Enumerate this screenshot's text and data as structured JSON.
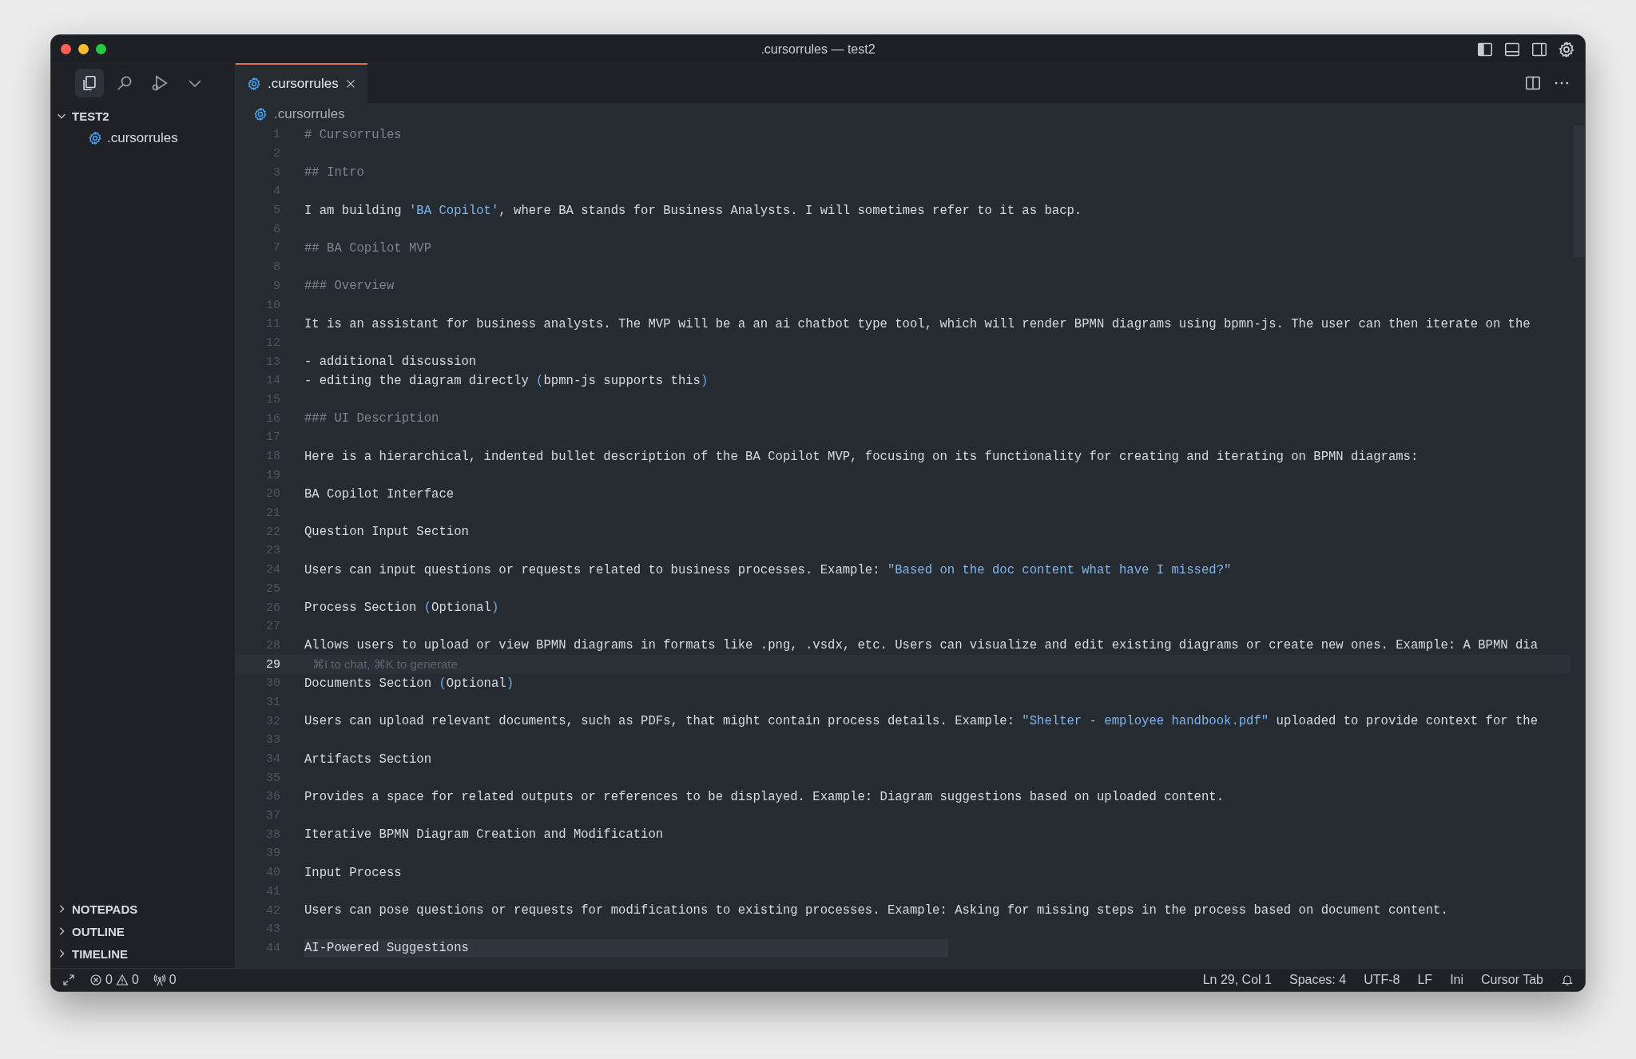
{
  "window": {
    "title": ".cursorrules — test2"
  },
  "activity_bar": [
    {
      "kind": "files",
      "selected": true
    },
    {
      "kind": "search",
      "selected": false
    },
    {
      "kind": "run",
      "selected": false
    },
    {
      "kind": "more",
      "selected": false
    }
  ],
  "explorer": {
    "label": "TEST2",
    "expanded": true,
    "children": [
      {
        "label": ".cursorrules",
        "kind": "settings-file"
      }
    ]
  },
  "sidebar_sections": [
    {
      "label": "NOTEPADS",
      "expanded": false
    },
    {
      "label": "OUTLINE",
      "expanded": false
    },
    {
      "label": "TIMELINE",
      "expanded": false
    }
  ],
  "tabs": [
    {
      "label": ".cursorrules",
      "kind": "settings-file",
      "selected": true
    }
  ],
  "breadcrumb": [
    {
      "label": ".cursorrules",
      "kind": "settings-file"
    }
  ],
  "editor": {
    "lines": [
      {
        "number": "1",
        "parts": [
          {
            "text": "# Cursorrules",
            "kind": "muted"
          }
        ]
      },
      {
        "number": "2"
      },
      {
        "number": "3",
        "parts": [
          {
            "text": "## Intro",
            "kind": "muted"
          }
        ]
      },
      {
        "number": "4"
      },
      {
        "number": "5",
        "parts": [
          {
            "text": "I am building ",
            "kind": "plain"
          },
          {
            "text": "'BA Copilot'",
            "kind": "string"
          },
          {
            "text": ", where BA stands for Business Analysts. I will sometimes refer to it as bacp.",
            "kind": "plain"
          }
        ]
      },
      {
        "number": "6"
      },
      {
        "number": "7",
        "parts": [
          {
            "text": "## BA Copilot MVP",
            "kind": "muted"
          }
        ]
      },
      {
        "number": "8"
      },
      {
        "number": "9",
        "parts": [
          {
            "text": "### Overview",
            "kind": "muted"
          }
        ]
      },
      {
        "number": "10"
      },
      {
        "number": "11",
        "parts": [
          {
            "text": "It is an assistant for business analysts. The MVP will be a an ai chatbot type tool, which will render BPMN diagrams using bpmn-js. The user can then iterate on the",
            "kind": "plain"
          }
        ]
      },
      {
        "number": "12"
      },
      {
        "number": "13",
        "parts": [
          {
            "text": "- additional discussion",
            "kind": "plain"
          }
        ]
      },
      {
        "number": "14",
        "parts": [
          {
            "text": "- editing the diagram directly ",
            "kind": "plain"
          },
          {
            "text": "(",
            "kind": "bracket"
          },
          {
            "text": "bpmn-js supports this",
            "kind": "plain"
          },
          {
            "text": ")",
            "kind": "bracket"
          }
        ]
      },
      {
        "number": "15"
      },
      {
        "number": "16",
        "parts": [
          {
            "text": "### UI Description",
            "kind": "muted"
          }
        ]
      },
      {
        "number": "17"
      },
      {
        "number": "18",
        "parts": [
          {
            "text": "Here is a hierarchical, indented bullet description of the BA Copilot MVP, focusing on its functionality for creating and iterating on BPMN diagrams:",
            "kind": "plain"
          }
        ]
      },
      {
        "number": "19"
      },
      {
        "number": "20",
        "parts": [
          {
            "text": "BA Copilot Interface",
            "kind": "plain"
          }
        ]
      },
      {
        "number": "21"
      },
      {
        "number": "22",
        "parts": [
          {
            "text": "Question Input Section",
            "kind": "plain"
          }
        ]
      },
      {
        "number": "23"
      },
      {
        "number": "24",
        "parts": [
          {
            "text": "Users can input questions or requests related to business processes. Example: ",
            "kind": "plain"
          },
          {
            "text": "\"Based on the doc content what have I missed?\"",
            "kind": "string"
          }
        ]
      },
      {
        "number": "25"
      },
      {
        "number": "26",
        "parts": [
          {
            "text": "Process Section ",
            "kind": "plain"
          },
          {
            "text": "(",
            "kind": "bracket"
          },
          {
            "text": "Optional",
            "kind": "plain"
          },
          {
            "text": ")",
            "kind": "bracket"
          }
        ]
      },
      {
        "number": "27"
      },
      {
        "number": "28",
        "parts": [
          {
            "text": "Allows users to upload or view BPMN diagrams in formats like .png, .vsdx, etc. Users can visualize and edit existing diagrams or create new ones. Example: A BPMN dia",
            "kind": "plain"
          }
        ]
      },
      {
        "number": "29",
        "selected": true,
        "hint": "⌘I to chat, ⌘K to generate"
      },
      {
        "number": "30",
        "parts": [
          {
            "text": "Documents Section ",
            "kind": "plain"
          },
          {
            "text": "(",
            "kind": "bracket"
          },
          {
            "text": "Optional",
            "kind": "plain"
          },
          {
            "text": ")",
            "kind": "bracket"
          }
        ]
      },
      {
        "number": "31"
      },
      {
        "number": "32",
        "parts": [
          {
            "text": "Users can upload relevant documents, such as PDFs, that might contain process details. Example: ",
            "kind": "plain"
          },
          {
            "text": "\"Shelter - employee handbook.pdf\"",
            "kind": "string"
          },
          {
            "text": " uploaded to provide context for the",
            "kind": "plain"
          }
        ]
      },
      {
        "number": "33"
      },
      {
        "number": "34",
        "parts": [
          {
            "text": "Artifacts Section",
            "kind": "plain"
          }
        ]
      },
      {
        "number": "35"
      },
      {
        "number": "36",
        "parts": [
          {
            "text": "Provides a space for related outputs or references to be displayed. Example: Diagram suggestions based on uploaded content.",
            "kind": "plain"
          }
        ]
      },
      {
        "number": "37"
      },
      {
        "number": "38",
        "parts": [
          {
            "text": "Iterative BPMN Diagram Creation and Modification",
            "kind": "plain"
          }
        ]
      },
      {
        "number": "39"
      },
      {
        "number": "40",
        "parts": [
          {
            "text": "Input Process",
            "kind": "plain"
          }
        ]
      },
      {
        "number": "41"
      },
      {
        "number": "42",
        "parts": [
          {
            "text": "Users can pose questions or requests for modifications to existing processes. Example: Asking for missing steps in the process based on document content.",
            "kind": "plain"
          }
        ]
      },
      {
        "number": "43"
      },
      {
        "number": "44",
        "highlighted": true,
        "parts": [
          {
            "text": "AI-Powered Suggestions",
            "kind": "plain"
          }
        ]
      }
    ]
  },
  "status_bar": {
    "errors": "0",
    "warnings": "0",
    "ports": "0",
    "items": [
      "Ln 29, Col 1",
      "Spaces: 4",
      "UTF-8",
      "LF",
      "Ini",
      "Cursor Tab"
    ]
  }
}
